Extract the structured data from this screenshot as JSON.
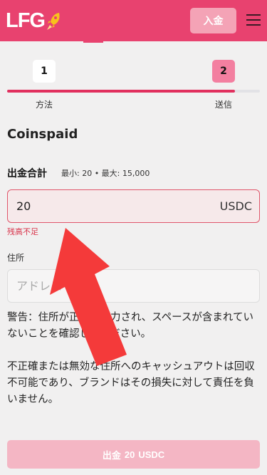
{
  "header": {
    "logo_text": "LFG",
    "deposit_label": "入金",
    "logo_icon": "rocket-icon",
    "menu_icon": "hamburger-menu-icon"
  },
  "steps": [
    {
      "number": "1",
      "label": "方法"
    },
    {
      "number": "2",
      "label": "送信"
    }
  ],
  "progress": 0.9,
  "title": "Coinspaid",
  "amount": {
    "label": "出金合計",
    "limits": "最小: 20 • 最大: 15,000",
    "value": "20",
    "currency": "USDC",
    "error": "残高不足"
  },
  "address": {
    "label": "住所",
    "placeholder": "アドレス"
  },
  "warning": [
    "警告：住所が正しく入力され、スペースが含まれていないことを確認してください。",
    "不正確または無効な住所へのキャッシュアウトは回収不可能であり、ブランドはその損失に対して責任を負いません。"
  ],
  "submit": {
    "label": "出金",
    "amount": "20",
    "currency": "USDC"
  },
  "colors": {
    "brand": "#e8426f",
    "error": "#d8334a",
    "annotation_arrow": "#f43a3a"
  }
}
